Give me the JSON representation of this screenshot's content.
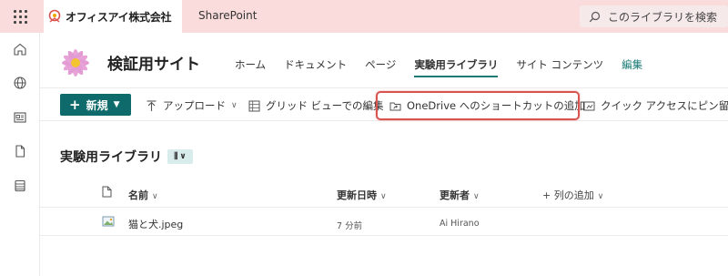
{
  "suite": {
    "brand": "オフィスアイ株式会社",
    "app": "SharePoint",
    "search_placeholder": "このライブラリを検索"
  },
  "site": {
    "title": "検証用サイト",
    "nav": [
      "ホーム",
      "ドキュメント",
      "ページ",
      "実験用ライブラリ",
      "サイト コンテンツ",
      "編集"
    ],
    "active_nav_index": 3
  },
  "commands": {
    "new": "新規",
    "upload": "アップロード",
    "grid_edit": "グリッド ビューでの編集",
    "onedrive_shortcut": "OneDrive へのショートカットの追加",
    "pin_quick_access": "クイック アクセスにピン留め"
  },
  "library": {
    "title": "実験用ライブラリ",
    "columns": {
      "name": "名前",
      "modified": "更新日時",
      "modified_by": "更新者",
      "add_column": "列の追加"
    },
    "rows": [
      {
        "name": "猫と犬.jpeg",
        "modified": "7 分前",
        "modified_by": "Ai Hirano"
      }
    ]
  },
  "colors": {
    "suite_bg": "#fbdcdc",
    "accent": "#0f6b6b",
    "highlight": "#d9534f"
  }
}
